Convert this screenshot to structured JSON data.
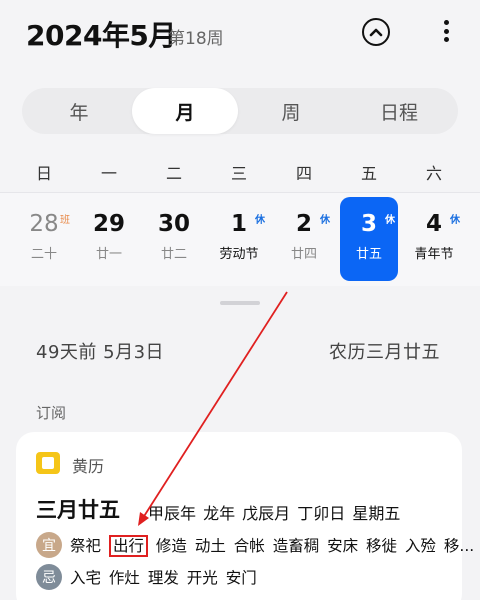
{
  "header": {
    "title": "2024年5月",
    "week": "第18周"
  },
  "tabs": [
    {
      "label": "年"
    },
    {
      "label": "月"
    },
    {
      "label": "周"
    },
    {
      "label": "日程"
    }
  ],
  "weekdays": [
    "日",
    "一",
    "二",
    "三",
    "四",
    "五",
    "六"
  ],
  "days": [
    {
      "num": "28",
      "sub": "二十",
      "tag": "班"
    },
    {
      "num": "29",
      "sub": "廿一",
      "tag": ""
    },
    {
      "num": "30",
      "sub": "廿二",
      "tag": ""
    },
    {
      "num": "1",
      "sub": "劳动节",
      "tag": "休"
    },
    {
      "num": "2",
      "sub": "廿四",
      "tag": "休"
    },
    {
      "num": "3",
      "sub": "廿五",
      "tag": "休"
    },
    {
      "num": "4",
      "sub": "青年节",
      "tag": "休"
    }
  ],
  "detail": {
    "relative_date": "49天前  5月3日",
    "lunar_date": "农历三月廿五",
    "subscribe_label": "订阅"
  },
  "almanac": {
    "title": "黄历",
    "lunar_day": "三月廿五",
    "ganzhi": "甲辰年 龙年 戊辰月 丁卯日 星期五",
    "yi_badge": "宜",
    "yi_before": "祭祀",
    "yi_highlight": "出行",
    "yi_after": "修造 动土 合帐 造畜稠 安床 移徙 入殓 移...",
    "ji_badge": "忌",
    "ji_items": "入宅 作灶 理发 开光 安门"
  },
  "colors": {
    "accent": "#0b66f5",
    "holiday_tag": "#1a6fe0",
    "work_tag": "#e88a4a",
    "annotation": "#e02020"
  }
}
